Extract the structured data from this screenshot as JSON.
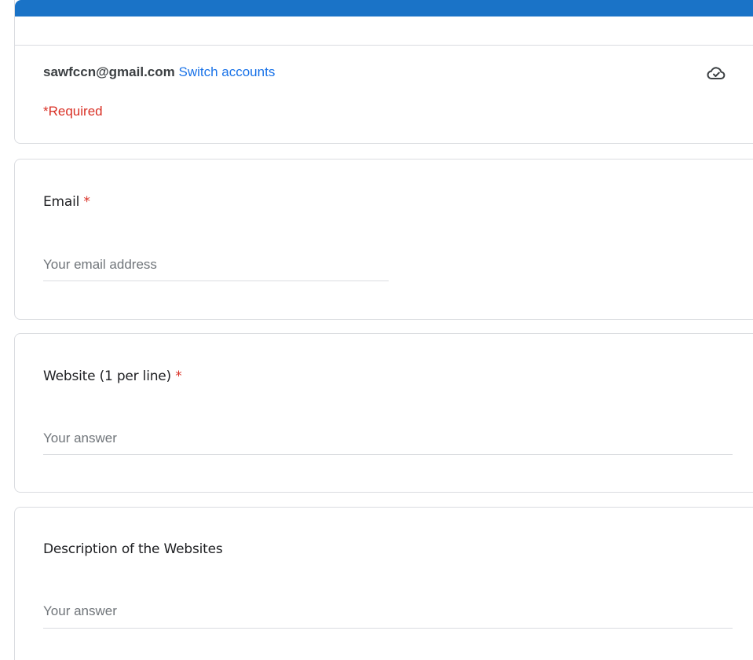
{
  "header": {
    "account_email": "sawfccn@gmail.com",
    "switch_accounts_label": "Switch accounts",
    "cloud_icon": "cloud-check-icon",
    "required_note": "*Required",
    "accent_color": "#1a73c7"
  },
  "questions": [
    {
      "title": "Email",
      "required_mark": "*",
      "placeholder": "Your email address"
    },
    {
      "title": "Website (1 per line)",
      "required_mark": "*",
      "placeholder": "Your answer"
    },
    {
      "title": "Description of the Websites",
      "required_mark": "",
      "placeholder": "Your answer"
    }
  ]
}
